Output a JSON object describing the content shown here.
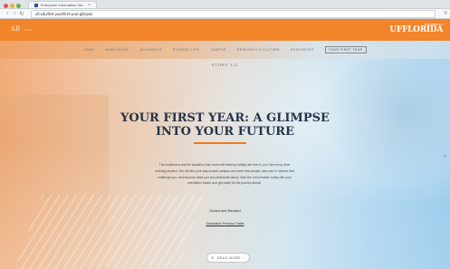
{
  "browser": {
    "tab_title": "Enterprise Information Mo...",
    "tab_close": "×",
    "url": "ufl.edu/first-year/first-year-glimpse",
    "nav_back": "‹",
    "nav_forward": "›",
    "nav_reload": "↻",
    "menu": "≡"
  },
  "header": {
    "left_logo": "AB",
    "left_logo_sub": "UNIV",
    "right_logo": "UF",
    "right_logo_main": "FLORIDA",
    "right_logo_sub": "UNIVERSITY of"
  },
  "subnav": {
    "items": [
      {
        "label": "HOME"
      },
      {
        "label": "ADMISSIONS"
      },
      {
        "label": "ACADEMICS"
      },
      {
        "label": "STUDENT LIFE"
      },
      {
        "label": "CAMPUS"
      },
      {
        "label": "RESEARCH & CULTURE"
      },
      {
        "label": "RESOURCES"
      },
      {
        "label": "YOUR FIRST YEAR"
      }
    ]
  },
  "hero": {
    "story_tag": "STORY 1/2",
    "title_line1": "YOUR FIRST YEAR: A GLIMPSE",
    "title_line2": "INTO YOUR FUTURE",
    "body": "The excitement and the transition that come with starting college are new to you, like every other entering student. You will find your way around campus and meet new people, take part in classes that challenge you, and discover what you are passionate about. Start the conversation today with your orientation leader and get ready for the journey ahead.",
    "link1": "Guided and Standard",
    "link2": "Orientation Preview Trailer",
    "read_button": "READ MORE",
    "read_icon_left": "◎",
    "read_icon_right": "›",
    "side_arrow": "›"
  },
  "colors": {
    "brand_orange": "#f2842a",
    "accent_rule": "#f07a1c",
    "title_navy": "#26344a"
  }
}
